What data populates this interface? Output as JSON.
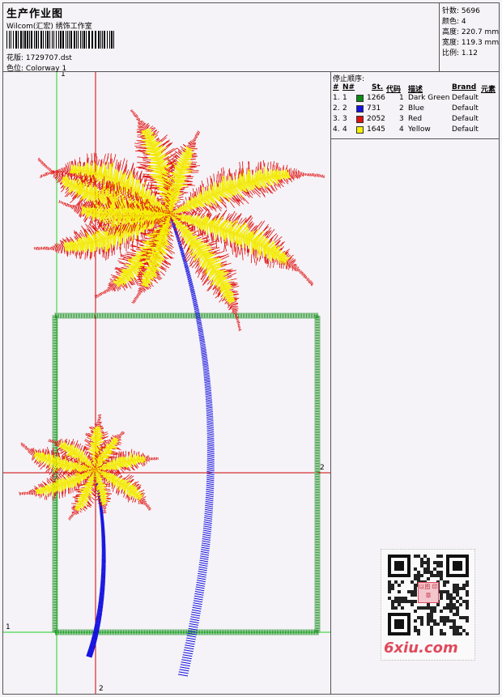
{
  "header": {
    "title": "生产作业图",
    "company": "Wilcom(汇宏) 绣饰工作室",
    "design_label": "花版:",
    "design_file": "1729707.dst",
    "colorway_label": "色位:",
    "colorway": "Colorway 1"
  },
  "stats": {
    "stitches_label": "针数:",
    "stitches": "5696",
    "colors_label": "颜色:",
    "colors": "4",
    "height_label": "高度:",
    "height": "220.7 mm",
    "width_label": "宽度:",
    "width": "119.3 mm",
    "ratio_label": "比例:",
    "ratio": "1.12"
  },
  "canvas": {
    "guide_green_top": "1",
    "guide_green_left": "1",
    "guide_red_right": "2",
    "guide_red_bottom": "2"
  },
  "legend": {
    "title": "停止顺序:",
    "headers": [
      "#",
      "N#",
      "St.",
      "代码",
      "描述",
      "Brand",
      "元素"
    ],
    "rows": [
      {
        "num": "1.",
        "n": "1",
        "color": "#0c8a14",
        "st": "1266",
        "code": "1",
        "desc": "Dark Green",
        "brand": "Default"
      },
      {
        "num": "2.",
        "n": "2",
        "color": "#1410e0",
        "st": "731",
        "code": "2",
        "desc": "Blue",
        "brand": "Default"
      },
      {
        "num": "3.",
        "n": "3",
        "color": "#e01010",
        "st": "2052",
        "code": "3",
        "desc": "Red",
        "brand": "Default"
      },
      {
        "num": "4.",
        "n": "4",
        "color": "#f4f000",
        "st": "1645",
        "code": "4",
        "desc": "Yellow",
        "brand": "Default"
      }
    ]
  },
  "qr": {
    "site": "6xiu.com",
    "stamp_text": "以图 印章"
  },
  "colors": {
    "green": "#0c8a14",
    "blue": "#1410e0",
    "red": "#e01010",
    "yellow": "#f4f000",
    "guide_green": "#20d020",
    "guide_red": "#d00000",
    "brand_pink": "#e04a5c"
  }
}
